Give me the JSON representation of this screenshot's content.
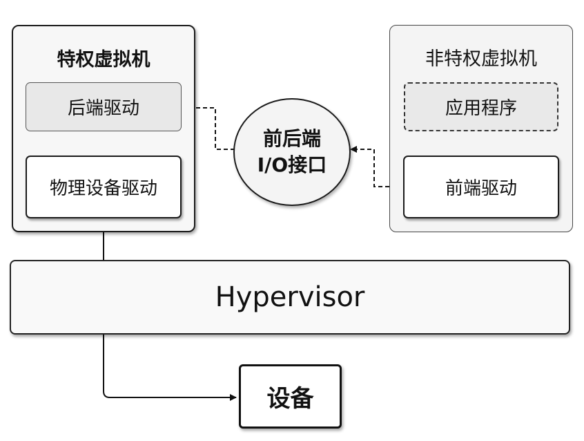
{
  "privileged_vm": {
    "title": "特权虚拟机",
    "backend_driver": "后端驱动",
    "physical_driver": "物理设备驱动"
  },
  "io_interface": {
    "line1": "前后端",
    "line2": "I/O接口"
  },
  "nonprivileged_vm": {
    "title": "非特权虚拟机",
    "application": "应用程序",
    "frontend_driver": "前端驱动"
  },
  "hypervisor": {
    "label": "Hypervisor"
  },
  "device": {
    "label": "设备"
  }
}
